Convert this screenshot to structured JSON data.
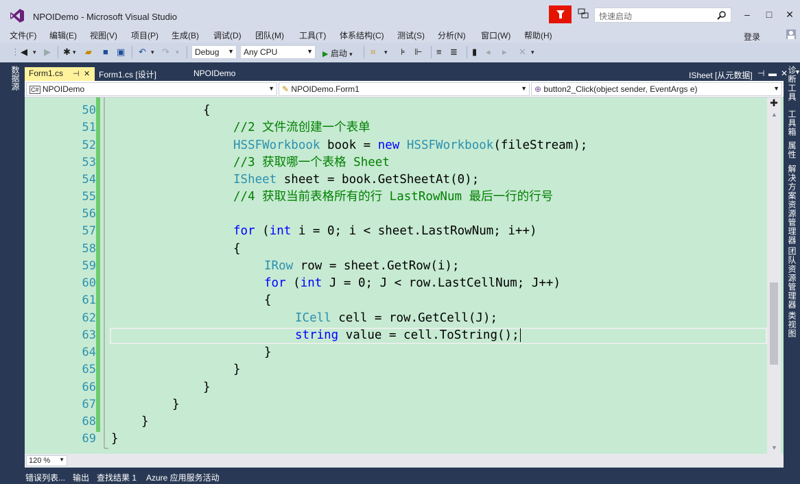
{
  "window": {
    "title": "NPOIDemo - Microsoft Visual Studio",
    "quick_launch_placeholder": "快速启动",
    "minimize": "–",
    "maximize": "□",
    "close": "✕"
  },
  "menu": {
    "items": [
      "文件(F)",
      "编辑(E)",
      "视图(V)",
      "项目(P)",
      "生成(B)",
      "调试(D)",
      "团队(M)",
      "工具(T)",
      "体系结构(C)",
      "测试(S)",
      "分析(N)",
      "窗口(W)",
      "帮助(H)"
    ],
    "login": "登录"
  },
  "toolbar": {
    "config": "Debug",
    "platform": "Any CPU",
    "start": "启动"
  },
  "left_panel": {
    "tab": "数据源"
  },
  "right_panel": {
    "tabs": [
      "诊断工具",
      "工具箱",
      "属性",
      "解决方案资源管理器",
      "团队资源管理器",
      "类视图"
    ]
  },
  "doc_tabs": {
    "tabs": [
      "Form1.cs",
      "Form1.cs [设计]",
      "NPOIDemo"
    ],
    "active_index": 0,
    "panel_title": "ISheet [从元数据]"
  },
  "navbar": {
    "project": "NPOIDemo",
    "class": "NPOIDemo.Form1",
    "member": "button2_Click(object sender, EventArgs e)"
  },
  "editor": {
    "line_numbers": [
      "50",
      "51",
      "52",
      "53",
      "54",
      "55",
      "56",
      "57",
      "58",
      "59",
      "60",
      "61",
      "62",
      "63",
      "64",
      "65",
      "66",
      "67",
      "68",
      "69"
    ],
    "zoom": "120 %"
  },
  "code_text": {
    "l50": "{",
    "l51": "//2 文件流创建一个表单",
    "l52a": "HSSFWorkbook",
    "l52b": " book = ",
    "l52c": "new",
    "l52d": " ",
    "l52e": "HSSFWorkbook",
    "l52f": "(fileStream);",
    "l53": "//3 获取哪一个表格 Sheet",
    "l54a": "ISheet",
    "l54b": " sheet = book.GetSheetAt(0);",
    "l55": "//4 获取当前表格所有的行 LastRowNum 最后一行的行号",
    "l57a": "for",
    "l57b": " (",
    "l57c": "int",
    "l57d": " i = 0; i < sheet.LastRowNum; i++)",
    "l58": "{",
    "l59a": "IRow",
    "l59b": " row = sheet.GetRow(i);",
    "l60a": "for",
    "l60b": " (",
    "l60c": "int",
    "l60d": " J = 0; J < row.LastCellNum; J++)",
    "l61": "{",
    "l62a": "ICell",
    "l62b": " cell = row.GetCell(J);",
    "l63a": "string",
    "l63b": " value = cell.ToString();",
    "l64": "}",
    "l65": "}",
    "l66": "}",
    "l67": "}",
    "l68": "}",
    "l69": "}"
  },
  "bottom_tabs": [
    "错误列表...",
    "输出",
    "查找结果 1",
    "Azure 应用服务活动"
  ]
}
